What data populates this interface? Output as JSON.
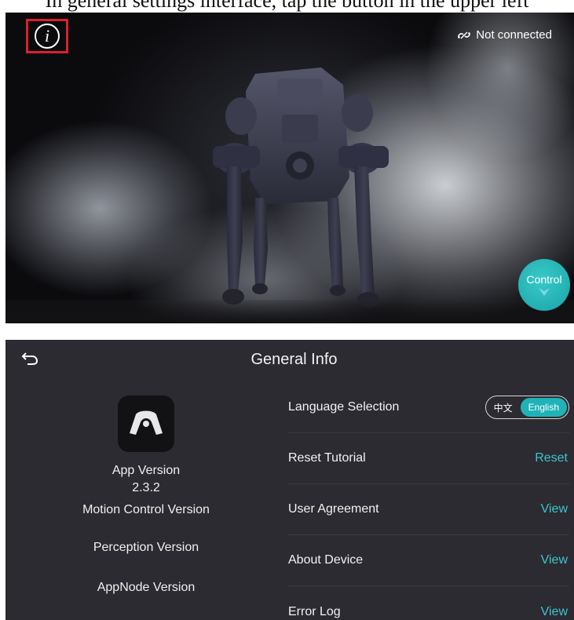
{
  "caption": "In general settings interface, tap the button in the upper left",
  "hero": {
    "connection_status": "Not connected",
    "control_label": "Control",
    "info_symbol": "i"
  },
  "general_info": {
    "title": "General Info",
    "versions": {
      "app_version_label": "App Version",
      "app_version_value": "2.3.2",
      "motion_control_label": "Motion Control Version",
      "perception_label": "Perception Version",
      "appnode_label": "AppNode Version"
    },
    "settings": [
      {
        "label": "Language Selection"
      },
      {
        "label": "Reset Tutorial",
        "action": "Reset"
      },
      {
        "label": "User Agreement",
        "action": "View"
      },
      {
        "label": "About Device",
        "action": "View"
      },
      {
        "label": "Error Log",
        "action": "View"
      }
    ],
    "language": {
      "chinese": "中文",
      "english": "English",
      "selected": "English"
    }
  },
  "colors": {
    "accent": "#1fb3b8",
    "highlight_box": "#d9222a",
    "panel_bg": "#2b2b31"
  },
  "icons": {
    "info": "info-icon",
    "connection": "link-icon",
    "back": "back-arrow-icon",
    "app": "app-logo-icon",
    "control_chevron": "chevron-down-icon"
  }
}
